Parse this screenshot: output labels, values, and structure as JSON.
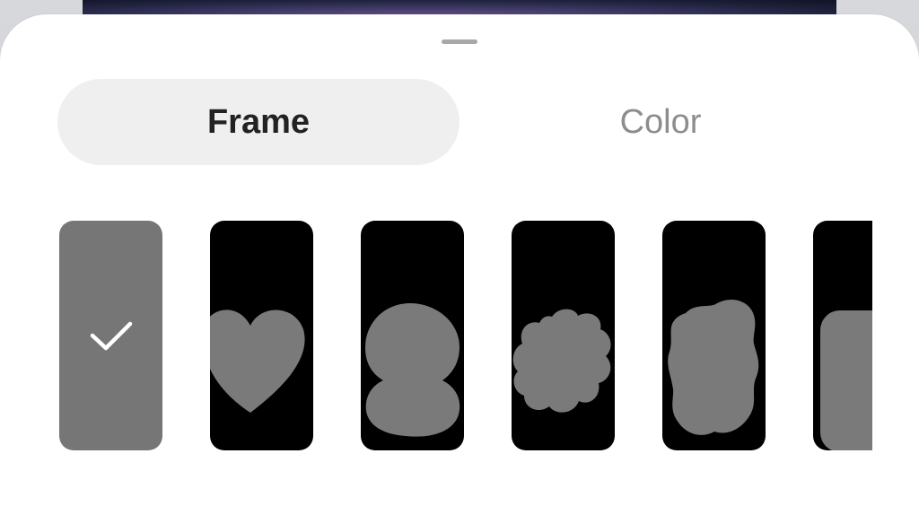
{
  "tabs": {
    "frame_label": "Frame",
    "color_label": "Color",
    "active": "Frame"
  },
  "frames": [
    {
      "shape": "none",
      "selected": true
    },
    {
      "shape": "heart",
      "selected": false
    },
    {
      "shape": "figure-eight",
      "selected": false
    },
    {
      "shape": "flower",
      "selected": false
    },
    {
      "shape": "wavy-oval",
      "selected": false
    },
    {
      "shape": "rounded-rectangle",
      "selected": false
    }
  ],
  "colors": {
    "sheet": "#ffffff",
    "selected_tab_bg": "#efefef",
    "selected_tab_text": "#222222",
    "unselected_tab_text": "#8d8d8d",
    "frame_bg": "#000000",
    "frame_shape": "#7a7a7a",
    "selected_frame_bg": "#767676"
  },
  "icons": {
    "drag_handle": "drag-handle-icon",
    "selected_check": "check-icon"
  }
}
